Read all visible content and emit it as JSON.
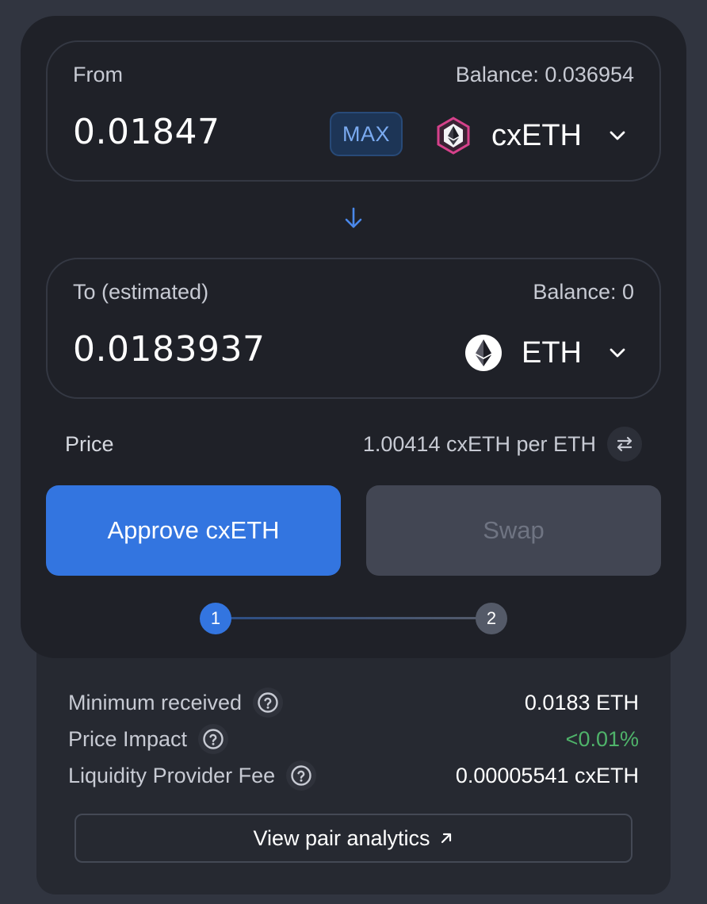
{
  "from": {
    "label": "From",
    "balance": "Balance: 0.036954",
    "amount": "0.01847",
    "max_label": "MAX",
    "token": {
      "symbol": "cxETH",
      "icon": "cxeth-token-icon"
    }
  },
  "direction_icon": "arrow-down-icon",
  "to": {
    "label": "To (estimated)",
    "balance": "Balance: 0",
    "amount": "0.0183937",
    "token": {
      "symbol": "ETH",
      "icon": "eth-token-icon"
    }
  },
  "price": {
    "label": "Price",
    "value": "1.00414 cxETH per ETH",
    "toggle_icon": "swap-direction-icon"
  },
  "actions": {
    "approve_label": "Approve cxETH",
    "swap_label": "Swap"
  },
  "stepper": {
    "steps": [
      "1",
      "2"
    ],
    "current": 1
  },
  "details": {
    "rows": [
      {
        "label": "Minimum received",
        "value": "0.0183 ETH"
      },
      {
        "label": "Price Impact",
        "value": "<0.01%"
      },
      {
        "label": "Liquidity Provider Fee",
        "value": "0.00005541 cxETH"
      }
    ],
    "analytics_label": "View pair analytics"
  },
  "colors": {
    "accent": "#3375e0",
    "positive": "#4fb36a",
    "card_bg": "#1f2128",
    "page_bg": "#313540"
  }
}
